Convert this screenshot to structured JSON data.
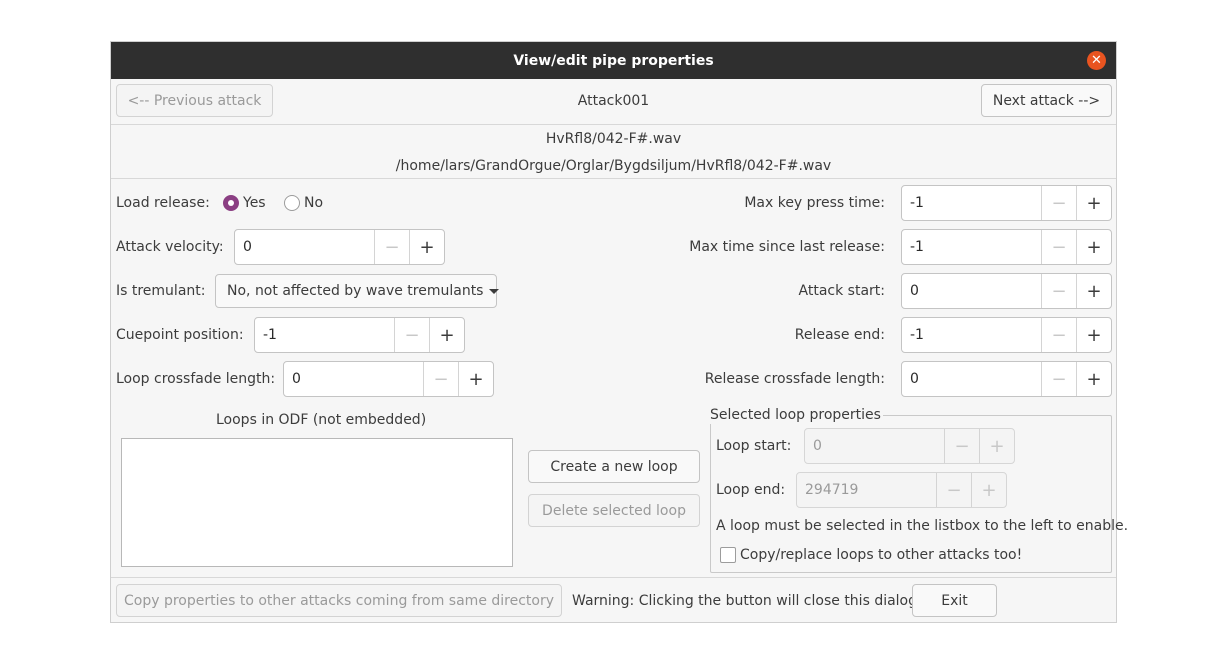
{
  "dialog": {
    "title": "View/edit pipe properties",
    "close_glyph": "✕"
  },
  "nav": {
    "previous_label": "<-- Previous attack",
    "attack_name": "Attack001",
    "next_label": "Next attack -->"
  },
  "file": {
    "name": "HvRfl8/042-F#.wav",
    "path": "/home/lars/GrandOrgue/Orglar/Bygdsiljum/HvRfl8/042-F#.wav"
  },
  "left": {
    "load_release_label": "Load release:",
    "load_release_yes": "Yes",
    "load_release_no": "No",
    "load_release_selected": "Yes",
    "attack_velocity_label": "Attack velocity:",
    "attack_velocity_value": "0",
    "is_tremulant_label": "Is tremulant:",
    "is_tremulant_value": "No, not affected by wave tremulants",
    "cuepoint_label": "Cuepoint position:",
    "cuepoint_value": "-1",
    "loop_crossfade_label": "Loop crossfade length:",
    "loop_crossfade_value": "0"
  },
  "right": {
    "max_key_press_label": "Max key press time:",
    "max_key_press_value": "-1",
    "max_since_release_label": "Max time since last release:",
    "max_since_release_value": "-1",
    "attack_start_label": "Attack start:",
    "attack_start_value": "0",
    "release_end_label": "Release end:",
    "release_end_value": "-1",
    "release_crossfade_label": "Release crossfade length:",
    "release_crossfade_value": "0"
  },
  "spin": {
    "minus": "−",
    "plus": "+"
  },
  "loops": {
    "list_title": "Loops in ODF (not embedded)",
    "items": [],
    "create_button": "Create a new loop",
    "delete_button": "Delete selected loop"
  },
  "selected_loop": {
    "group_title": "Selected loop properties",
    "loop_start_label": "Loop start:",
    "loop_start_value": "0",
    "loop_end_label": "Loop end:",
    "loop_end_value": "294719",
    "hint": "A loop must be selected in the listbox to the left to enable.",
    "copy_loops_label": "Copy/replace loops to other attacks too!",
    "copy_loops_checked": false
  },
  "footer": {
    "copy_button": "Copy properties to other attacks coming from same directory",
    "warning": "Warning: Clicking the button will close this dialog!",
    "exit_button": "Exit"
  },
  "colors": {
    "titlebar": "#2f2f2f",
    "close_button": "#e95420",
    "radio_accent": "#8b3f83",
    "dialog_bg": "#f6f6f6"
  }
}
